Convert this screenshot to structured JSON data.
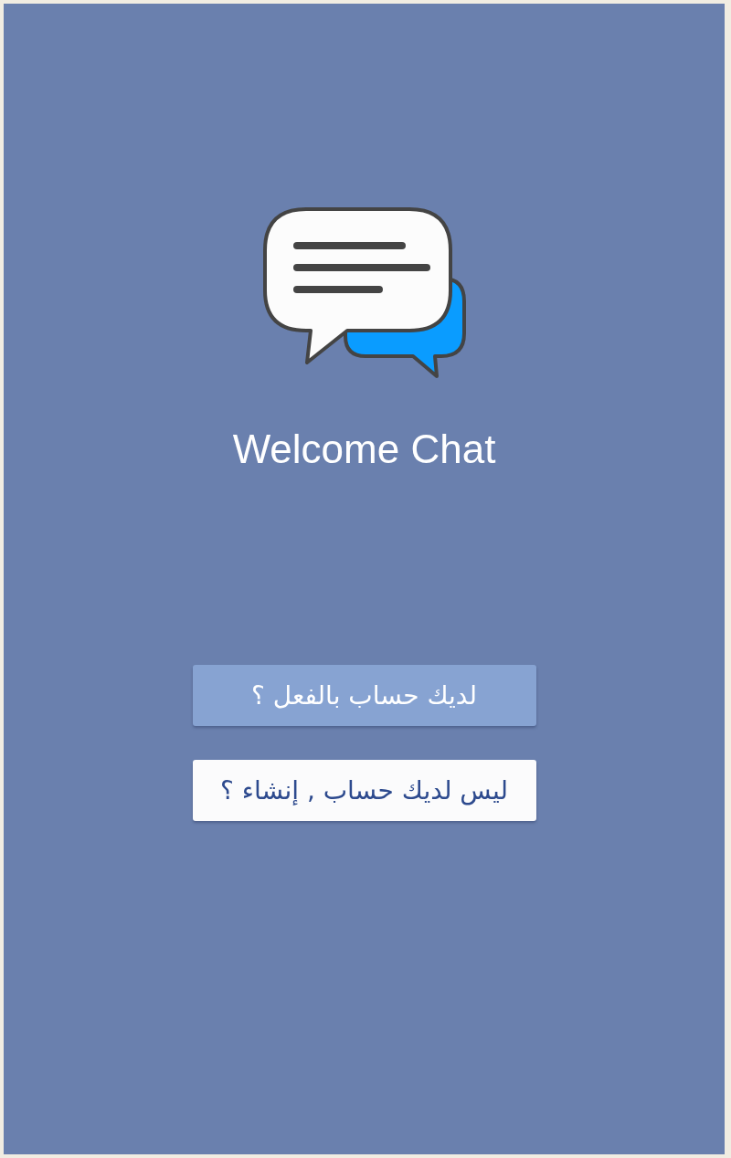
{
  "app": {
    "title": "Welcome Chat"
  },
  "buttons": [
    {
      "label": "لديك حساب بالفعل ؟",
      "kind": "primary"
    },
    {
      "label": "ليس لديك حساب , إنشاء ؟",
      "kind": "secondary"
    }
  ]
}
